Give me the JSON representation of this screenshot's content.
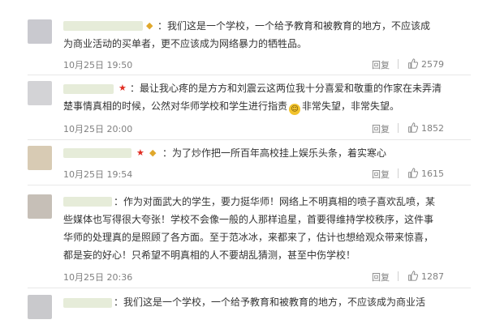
{
  "reply_label": "回复",
  "comments": [
    {
      "lines": [
        "：我们这是一个学校，一个给予教育和被教育的地方，不应该成",
        "为商业活动的买单者，更不应该成为网络暴力的牺牲品。"
      ],
      "time": "10月25日 19:50",
      "likes": "2579"
    },
    {
      "lines": [
        "：最让我心疼的是方方和刘震云这两位我十分喜爱和敬重的作家在未弄清",
        "楚事情真相的时候，公然对华师学校和学生进行指责",
        "非常失望，非常失望。"
      ],
      "time": "10月25日 20:00",
      "likes": "1852"
    },
    {
      "lines": [
        "：为了炒作把一所百年高校挂上娱乐头条，着实寒心"
      ],
      "time": "10月25日 19:54",
      "likes": "1615"
    },
    {
      "lines": [
        "：作为对面武大的学生，要力挺华师！网络上不明真相的喷子喜欢乱喷，某",
        "些媒体也写得很大夸张！学校不会像一般的人那样追星，首要得维持学校秩序，这件事",
        "华师的处理真的是照顾了各方面。至于范冰冰，来都来了，估计也想给观众带来惊喜，",
        "都是妄的好心！只希望不明真相的人不要胡乱猜测，甚至中伤学校！"
      ],
      "time": "10月25日 20:36",
      "likes": "1287"
    },
    {
      "lines": [
        "：我们这是一个学校，一个给予教育和被教育的地方，不应该成为商业活"
      ]
    }
  ]
}
